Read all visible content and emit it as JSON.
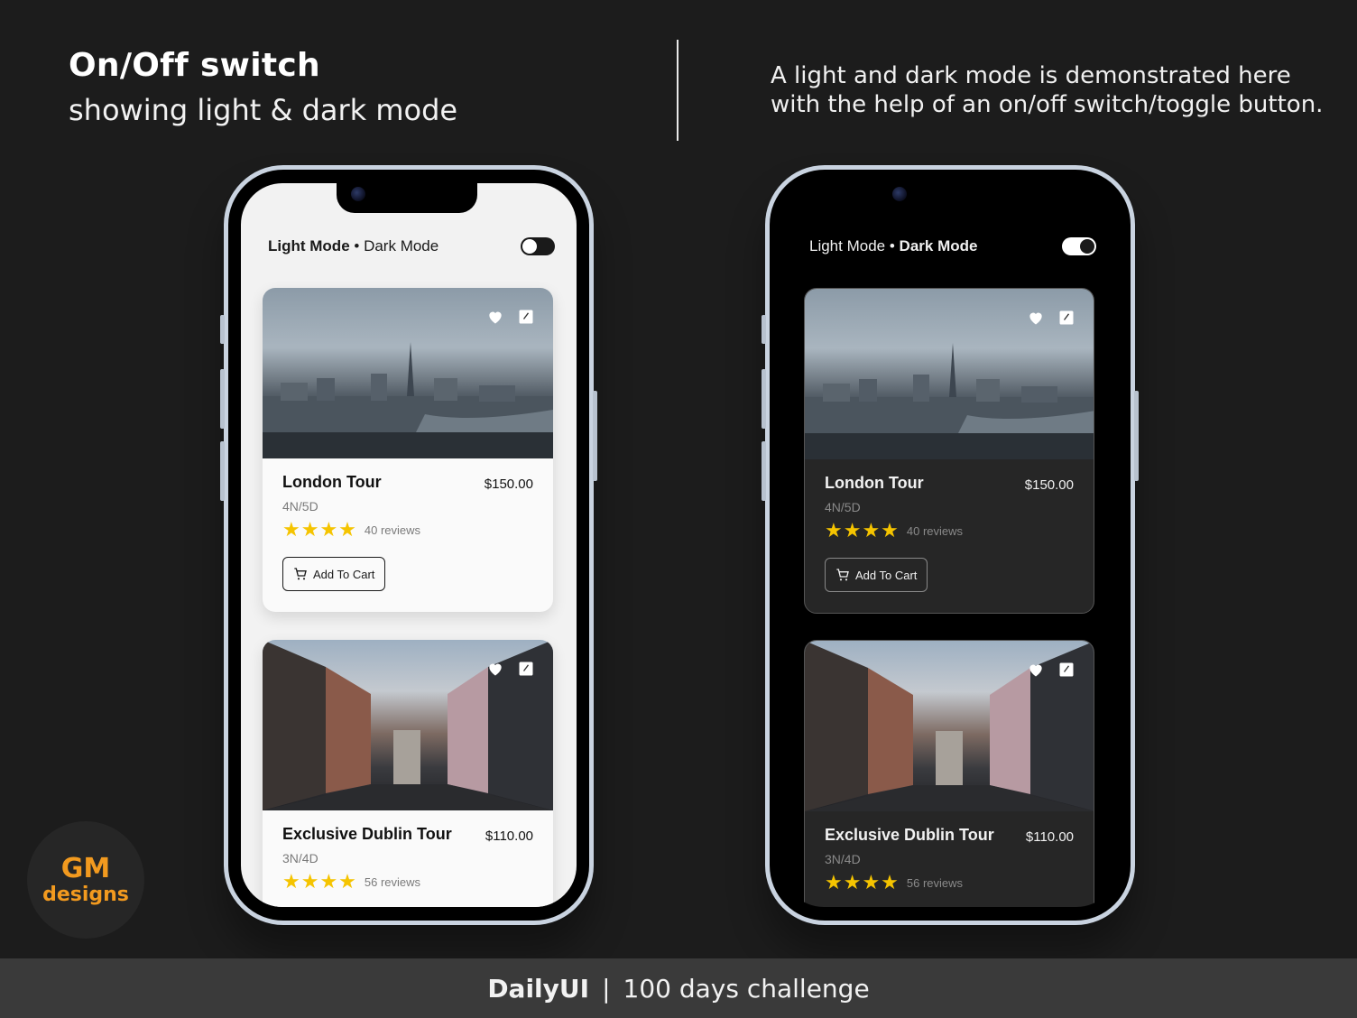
{
  "header": {
    "title": "On/Off switch",
    "subtitle": "showing light & dark mode",
    "description_line1": "A light and dark mode is demonstrated here",
    "description_line2": "with the help of an on/off switch/toggle button."
  },
  "app": {
    "mode_light": "Light Mode",
    "mode_separator": "•",
    "mode_dark": "Dark Mode",
    "cart_label": "Add To Cart",
    "stars": "★★★★"
  },
  "tours": [
    {
      "name": "London Tour",
      "price": "$150.00",
      "duration": "4N/5D",
      "reviews": "40 reviews",
      "rating": 4
    },
    {
      "name": "Exclusive Dublin Tour",
      "price": "$110.00",
      "duration": "3N/4D",
      "reviews": "56 reviews",
      "rating": 4
    }
  ],
  "logo": {
    "mark": "GM",
    "word": "designs"
  },
  "footer": {
    "bold": "DailyUI",
    "separator": "|",
    "rest": "100 days challenge"
  },
  "colors": {
    "background": "#1c1c1c",
    "star": "#f5c400",
    "brand_orange": "#f29a1f",
    "footer": "#3a3a3a"
  }
}
